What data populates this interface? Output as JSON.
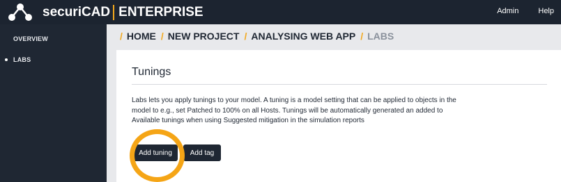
{
  "app": {
    "brand_name": "securiCAD",
    "brand_edition": "ENTERPRISE",
    "accent_color": "#f2a81d",
    "highlight_color": "#f5a516",
    "logo_icon": "molecule-icon"
  },
  "topnav": {
    "items": [
      {
        "label": "Admin"
      },
      {
        "label": "Help"
      }
    ]
  },
  "sidebar": {
    "items": [
      {
        "label": "OVERVIEW",
        "active": false
      },
      {
        "label": "LABS",
        "active": true
      }
    ]
  },
  "breadcrumb": {
    "items": [
      {
        "label": "HOME"
      },
      {
        "label": "NEW PROJECT"
      },
      {
        "label": "ANALYSING WEB APP"
      },
      {
        "label": "LABS",
        "current": true
      }
    ]
  },
  "main": {
    "title": "Tunings",
    "description_lines": [
      "Labs lets you apply tunings to your model. A tuning is a model setting that can be applied to objects in the",
      "model to e.g., set Patched to 100% on all Hosts. Tunings will be automatically generated an added to",
      "Available tunings when using Suggested mitigation in the simulation reports"
    ],
    "buttons": {
      "add_tuning": "Add tuning",
      "add_tag": "Add tag"
    }
  }
}
